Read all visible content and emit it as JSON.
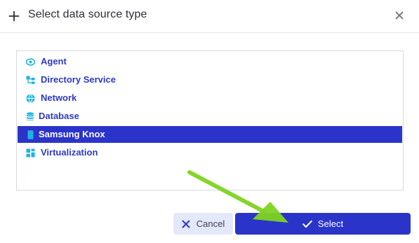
{
  "dialog": {
    "title": "Select data source type",
    "icons": {
      "header": "plus-icon",
      "close": "close-icon"
    }
  },
  "sources": [
    {
      "label": "Agent",
      "icon": "eye-icon",
      "selected": false
    },
    {
      "label": "Directory Service",
      "icon": "directory-tree-icon",
      "selected": false
    },
    {
      "label": "Network",
      "icon": "globe-icon",
      "selected": false
    },
    {
      "label": "Database",
      "icon": "database-icon",
      "selected": false
    },
    {
      "label": "Samsung Knox",
      "icon": "mobile-phone-icon",
      "selected": true
    },
    {
      "label": "Virtualization",
      "icon": "virtualization-icon",
      "selected": false
    }
  ],
  "buttons": {
    "cancel_label": "Cancel",
    "select_label": "Select"
  },
  "colors": {
    "accent": "#2b34c9",
    "icon_cyan": "#1fb3e0",
    "label_blue": "#2e3bbf",
    "annotation_arrow": "#7ed321"
  }
}
